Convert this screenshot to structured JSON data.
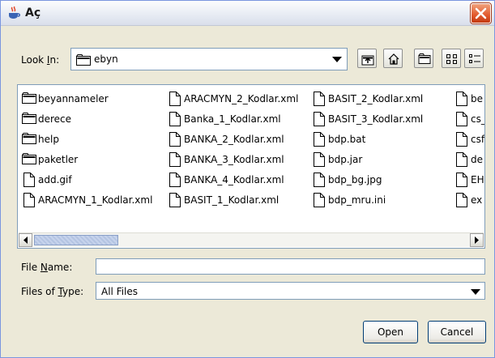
{
  "window": {
    "title": "Aç"
  },
  "lookin": {
    "label_pre": "Look ",
    "label_u": "I",
    "label_post": "n:",
    "value": "ebyn"
  },
  "files": [
    {
      "name": "beyannameler",
      "kind": "folder"
    },
    {
      "name": "derece",
      "kind": "folder"
    },
    {
      "name": "help",
      "kind": "folder"
    },
    {
      "name": "paketler",
      "kind": "folder"
    },
    {
      "name": "add.gif",
      "kind": "file"
    },
    {
      "name": "ARACMYN_1_Kodlar.xml",
      "kind": "file"
    },
    {
      "name": "ARACMYN_2_Kodlar.xml",
      "kind": "file"
    },
    {
      "name": "Banka_1_Kodlar.xml",
      "kind": "file"
    },
    {
      "name": "BANKA_2_Kodlar.xml",
      "kind": "file"
    },
    {
      "name": "BANKA_3_Kodlar.xml",
      "kind": "file"
    },
    {
      "name": "BANKA_4_Kodlar.xml",
      "kind": "file"
    },
    {
      "name": "BASIT_1_Kodlar.xml",
      "kind": "file"
    },
    {
      "name": "BASIT_2_Kodlar.xml",
      "kind": "file"
    },
    {
      "name": "BASIT_3_Kodlar.xml",
      "kind": "file"
    },
    {
      "name": "bdp.bat",
      "kind": "file"
    },
    {
      "name": "bdp.jar",
      "kind": "file"
    },
    {
      "name": "bdp_bg.jpg",
      "kind": "file"
    },
    {
      "name": "bdp_mru.ini",
      "kind": "file"
    },
    {
      "name": "be",
      "kind": "file"
    },
    {
      "name": "cs_",
      "kind": "file"
    },
    {
      "name": "csf",
      "kind": "file"
    },
    {
      "name": "de",
      "kind": "file"
    },
    {
      "name": "EH",
      "kind": "file"
    },
    {
      "name": "ex",
      "kind": "file"
    }
  ],
  "filename": {
    "label_pre": "File ",
    "label_u": "N",
    "label_post": "ame:",
    "value": ""
  },
  "filetype": {
    "label_pre": "Files of ",
    "label_u": "T",
    "label_post": "ype:",
    "value": "All Files"
  },
  "buttons": {
    "open": "Open",
    "cancel": "Cancel"
  },
  "icons": {
    "title": "java-cup-icon",
    "close": "close-icon",
    "up": "up-folder-icon",
    "home": "home-icon",
    "newfolder": "new-folder-icon",
    "list": "list-view-icon",
    "details": "details-view-icon"
  }
}
